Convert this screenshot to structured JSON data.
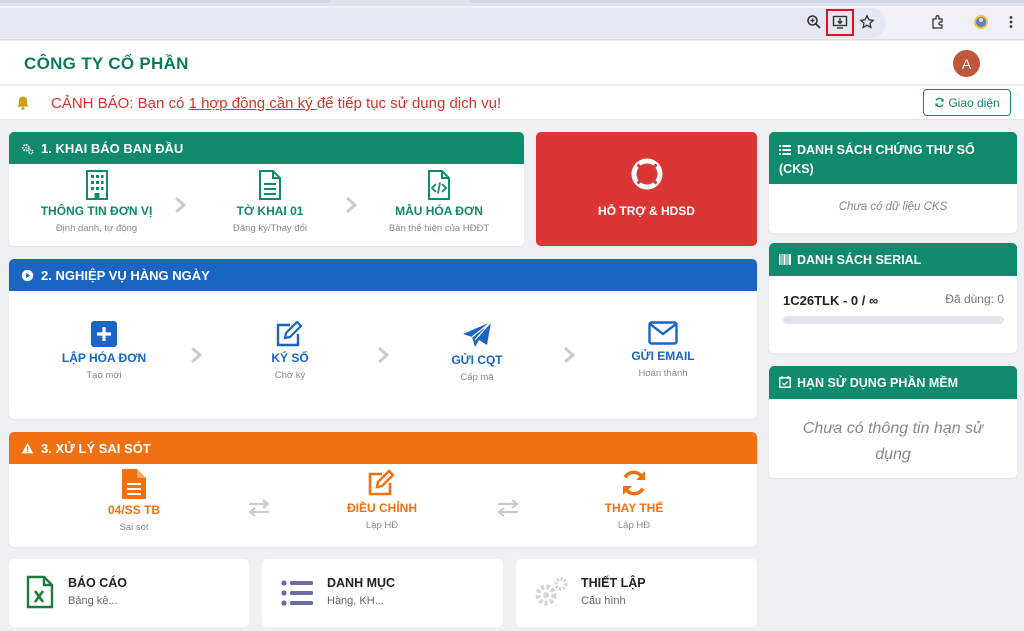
{
  "browser": {
    "icons": [
      "zoom-icon",
      "install-app-icon",
      "bookmark-star-icon",
      "extensions-icon",
      "profile-icon",
      "menu-dots-icon"
    ]
  },
  "header": {
    "company": "CÔNG TY CỔ PHẦN",
    "avatar_letter": "A"
  },
  "warning": {
    "prefix": "CẢNH BÁO: Bạn có ",
    "link": "1 hợp đồng cần ký ",
    "suffix": "để tiếp tục sử dụng dịch vụ!",
    "theme_button": "Giao diện"
  },
  "section1": {
    "title": "1. KHAI BÁO BAN ĐẦU",
    "steps": [
      {
        "title": "THÔNG TIN ĐƠN VỊ",
        "sub": "Định danh, tự động"
      },
      {
        "title": "TỜ KHAI 01",
        "sub": "Đăng ký/Thay đổi"
      },
      {
        "title": "MẪU HÓA ĐƠN",
        "sub": "Bản thể hiện của HĐĐT"
      }
    ]
  },
  "support": {
    "label": "HỖ TRỢ & HDSD"
  },
  "section2": {
    "title": "2. NGHIỆP VỤ HÀNG NGÀY",
    "steps": [
      {
        "title": "LẬP HÓA ĐƠN",
        "sub": "Tạo mới"
      },
      {
        "title": "KÝ SỐ",
        "sub": "Chờ ký"
      },
      {
        "title": "GỬI CQT",
        "sub": "Cấp mã"
      },
      {
        "title": "GỬI EMAIL",
        "sub": "Hoàn thành"
      }
    ]
  },
  "section3": {
    "title": "3. XỬ LÝ SAI SÓT",
    "steps": [
      {
        "title": "04/SS TB",
        "sub": "Sai sót"
      },
      {
        "title": "ĐIỀU CHỈNH",
        "sub": "Lập HĐ"
      },
      {
        "title": "THAY THẾ",
        "sub": "Lập HĐ"
      }
    ]
  },
  "bottom": [
    {
      "title": "BÁO CÁO",
      "sub": "Bảng kê..."
    },
    {
      "title": "DANH MỤC",
      "sub": "Hàng, KH..."
    },
    {
      "title": "THIẾT LẬP",
      "sub": "Cấu hình"
    }
  ],
  "side": {
    "cks": {
      "title": "DANH SÁCH CHỨNG THƯ SỐ (CKS)",
      "empty": "Chưa có dữ liệu CKS"
    },
    "serial": {
      "title": "DANH SÁCH SERIAL",
      "serial": "1C26TLK - 0 / ∞",
      "used": "Đã dùng: 0",
      "usage_fraction": 0
    },
    "license": {
      "title": "HẠN SỬ DỤNG PHẦN MỀM",
      "empty": "Chưa có thông tin hạn sử dụng"
    }
  },
  "colors": {
    "green": "#0f8a6c",
    "blue": "#1a64c2",
    "orange": "#f07012",
    "red": "#dc3535",
    "dark_green_text": "#0c7a5e"
  }
}
